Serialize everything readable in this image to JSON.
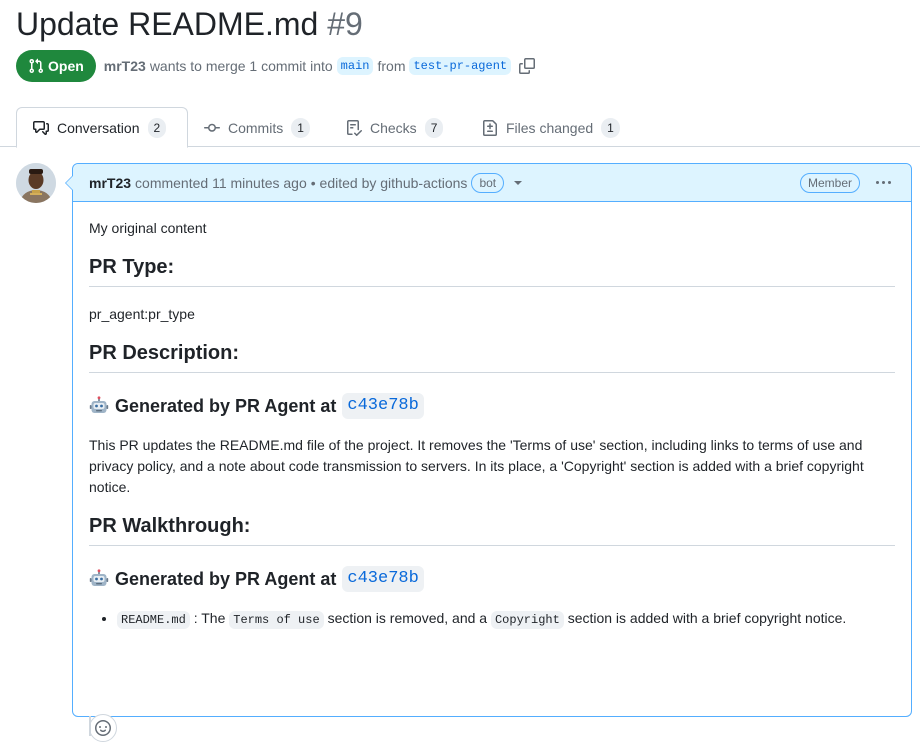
{
  "pr": {
    "title": "Update README.md",
    "number": "#9",
    "state": "Open",
    "author": "mrT23",
    "merge_text": "wants to merge 1 commit into",
    "base_branch": "main",
    "from_text": "from",
    "head_branch": "test-pr-agent"
  },
  "tabs": [
    {
      "label": "Conversation",
      "count": "2",
      "icon": "comment-discussion-icon"
    },
    {
      "label": "Commits",
      "count": "1",
      "icon": "git-commit-icon"
    },
    {
      "label": "Checks",
      "count": "7",
      "icon": "checklist-icon"
    },
    {
      "label": "Files changed",
      "count": "1",
      "icon": "file-diff-icon"
    }
  ],
  "comment": {
    "author": "mrT23",
    "meta": "commented 11 minutes ago",
    "edited": "• edited by github-actions",
    "bot_label": "bot",
    "role_label": "Member",
    "body": {
      "intro": "My original content",
      "pr_type_heading": "PR Type:",
      "pr_type_value": "pr_agent:pr_type",
      "pr_description_heading": "PR Description:",
      "generated_by": "Generated by PR Agent at",
      "sha": "c43e78b",
      "description_text": "This PR updates the README.md file of the project. It removes the 'Terms of use' section, including links to terms of use and privacy policy, and a note about code transmission to servers. In its place, a 'Copyright' section is added with a brief copyright notice.",
      "walkthrough_heading": "PR Walkthrough:",
      "walkthrough_generated_by": "Generated by PR Agent at",
      "walkthrough_sha": "c43e78b",
      "bullet": {
        "file": "README.md",
        "text1": ": The",
        "code1": "Terms of use",
        "text2": "section is removed, and a",
        "code2": "Copyright",
        "text3": "section is added with a brief copyright notice."
      }
    }
  },
  "colors": {
    "open_green": "#1f883d",
    "link_blue": "#0969da",
    "header_blue": "#ddf4ff",
    "border_blue": "#54aeff"
  }
}
